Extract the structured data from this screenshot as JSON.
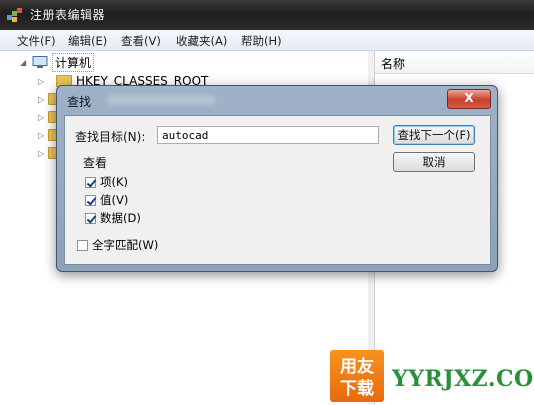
{
  "window": {
    "title": "注册表编辑器"
  },
  "menu": [
    "文件(F)",
    "编辑(E)",
    "查看(V)",
    "收藏夹(A)",
    "帮助(H)"
  ],
  "tree": {
    "root_label": "计算机",
    "first_key": "HKEY_CLASSES_ROOT"
  },
  "list": {
    "column_name": "名称"
  },
  "dialog": {
    "title": "查找",
    "close_symbol": "X",
    "target_label": "查找目标(N):",
    "target_value": "autocad",
    "find_next_label": "查找下一个(F)",
    "cancel_label": "取消",
    "look_at_label": "查看",
    "options": [
      {
        "label": "项(K)",
        "checked": true
      },
      {
        "label": "值(V)",
        "checked": true
      },
      {
        "label": "数据(D)",
        "checked": true
      }
    ],
    "match_whole": {
      "label": "全字匹配(W)",
      "checked": false
    }
  },
  "watermark": {
    "logo_text": "用友下载",
    "site": "YYRJXZ.COM"
  },
  "colors": {
    "title_bar": "#2b2b2b",
    "dialog_frame": "#8ca2b9",
    "close_button": "#c7402c",
    "watermark_orange": "#f7931e",
    "watermark_green": "#2a8f3a"
  }
}
